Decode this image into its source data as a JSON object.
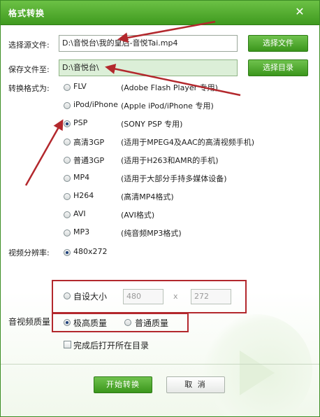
{
  "window": {
    "title": "格式转换",
    "close_glyph": "✕"
  },
  "source": {
    "label": "选择源文件:",
    "value": "D:\\音悦台\\我的皇后-音悦Tai.mp4",
    "button": "选择文件"
  },
  "save": {
    "label": "保存文件至:",
    "value": "D:\\音悦台\\",
    "button": "选择目录"
  },
  "format": {
    "label": "转换格式为:",
    "selected": "PSP",
    "options": [
      {
        "name": "FLV",
        "desc": "(Adobe Flash Player 专用)"
      },
      {
        "name": "iPod/iPhone",
        "desc": "(Apple iPod/iPhone 专用)"
      },
      {
        "name": "PSP",
        "desc": "(SONY PSP 专用)"
      },
      {
        "name": "高清3GP",
        "desc": "(适用于MPEG4及AAC的高清视频手机)"
      },
      {
        "name": "普通3GP",
        "desc": "(适用于H263和AMR的手机)"
      },
      {
        "name": "MP4",
        "desc": "(适用于大部分手持多媒体设备)"
      },
      {
        "name": "H264",
        "desc": "(高清MP4格式)"
      },
      {
        "name": "AVI",
        "desc": "(AVI格式)"
      },
      {
        "name": "MP3",
        "desc": "(纯音频MP3格式)"
      }
    ]
  },
  "resolution": {
    "label": "视频分辨率:",
    "preset": "480x272",
    "custom_label": "自设大小",
    "width": "480",
    "separator": "x",
    "height": "272"
  },
  "quality": {
    "label": "音视频质量",
    "high": "极高质量",
    "normal": "普通质量",
    "selected": "high"
  },
  "open_after": {
    "label": "完成后打开所在目录",
    "checked": false
  },
  "buttons": {
    "start": "开始转换",
    "cancel": "取 消"
  },
  "colors": {
    "accent": "#4aa827",
    "annotation_red": "#b3282d"
  }
}
